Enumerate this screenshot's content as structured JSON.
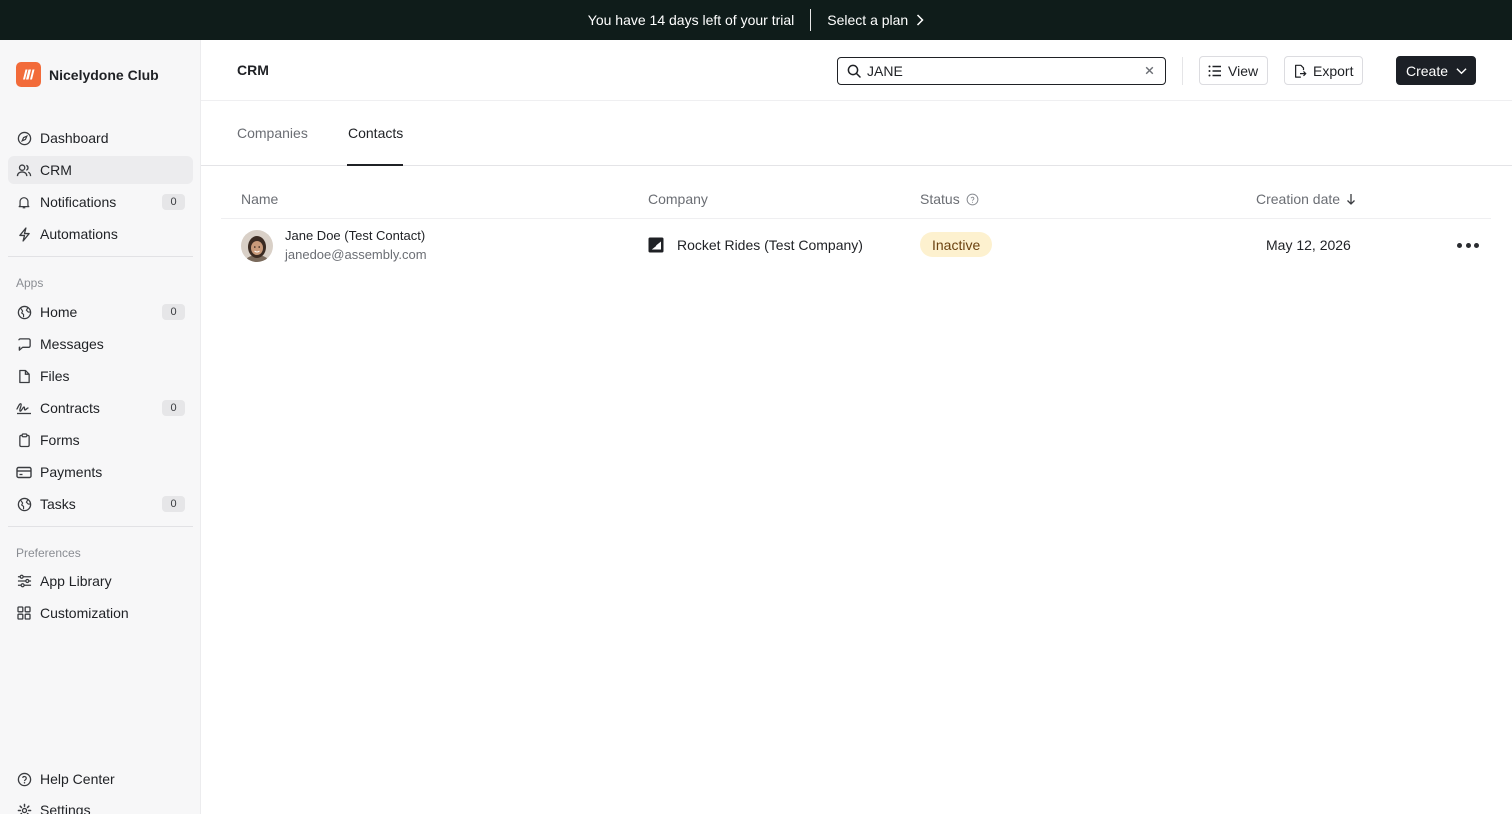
{
  "banner": {
    "message": "You have 14 days left of your trial",
    "cta": "Select a plan"
  },
  "sidebar": {
    "workspace_name": "Nicelydone Club",
    "main_items": [
      {
        "label": "Dashboard",
        "icon": "compass-icon"
      },
      {
        "label": "CRM",
        "icon": "users-icon",
        "active": true
      },
      {
        "label": "Notifications",
        "icon": "bell-icon",
        "badge": "0"
      },
      {
        "label": "Automations",
        "icon": "lightning-icon"
      }
    ],
    "apps_heading": "Apps",
    "app_items": [
      {
        "label": "Home",
        "icon": "globe-icon",
        "badge": "0"
      },
      {
        "label": "Messages",
        "icon": "message-icon"
      },
      {
        "label": "Files",
        "icon": "file-icon"
      },
      {
        "label": "Contracts",
        "icon": "signature-icon",
        "badge": "0"
      },
      {
        "label": "Forms",
        "icon": "clipboard-icon"
      },
      {
        "label": "Payments",
        "icon": "credit-card-icon"
      },
      {
        "label": "Tasks",
        "icon": "globe-icon",
        "badge": "0"
      }
    ],
    "preferences_heading": "Preferences",
    "preference_items": [
      {
        "label": "App Library",
        "icon": "sliders-icon"
      },
      {
        "label": "Customization",
        "icon": "grid-icon"
      }
    ],
    "footer_items": [
      {
        "label": "Help Center",
        "icon": "help-icon"
      },
      {
        "label": "Settings",
        "icon": "gear-icon"
      }
    ]
  },
  "header": {
    "title": "CRM",
    "search_value": "JANE",
    "view_label": "View",
    "export_label": "Export",
    "create_label": "Create"
  },
  "tabs": [
    {
      "label": "Companies",
      "active": false
    },
    {
      "label": "Contacts",
      "active": true
    }
  ],
  "table": {
    "columns": {
      "name": "Name",
      "company": "Company",
      "status": "Status",
      "creation_date": "Creation date"
    },
    "rows": [
      {
        "name": "Jane Doe (Test Contact)",
        "email": "janedoe@assembly.com",
        "company": "Rocket Rides (Test Company)",
        "status": "Inactive",
        "creation_date": "May 12, 2026"
      }
    ]
  },
  "colors": {
    "banner_bg": "#0f1c1a",
    "brand_logo": "#f26b3a",
    "status_inactive_bg": "#fdf1cf",
    "status_inactive_text": "#6b4210",
    "primary_button": "#1c2026"
  }
}
